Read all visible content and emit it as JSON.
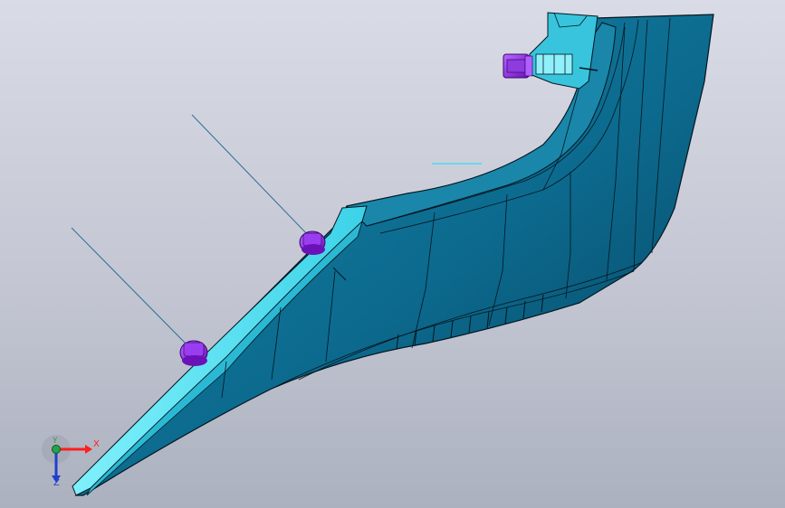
{
  "viewport": {
    "background_top": "#d9dbe6",
    "background_bottom": "#acb1bf"
  },
  "model": {
    "part_color": "#0c6a8e",
    "part_dark_color": "#07415c",
    "flange_color": "#52dff2",
    "fastener_color": "#9a3df0",
    "fastener_count": 3,
    "edge_color": "#03161f"
  },
  "triad": {
    "x_label": "X",
    "y_label": "Y",
    "z_label": "Z",
    "x_color": "#ff1e1e",
    "y_color": "#22a34a",
    "z_color": "#1f3fd0"
  }
}
